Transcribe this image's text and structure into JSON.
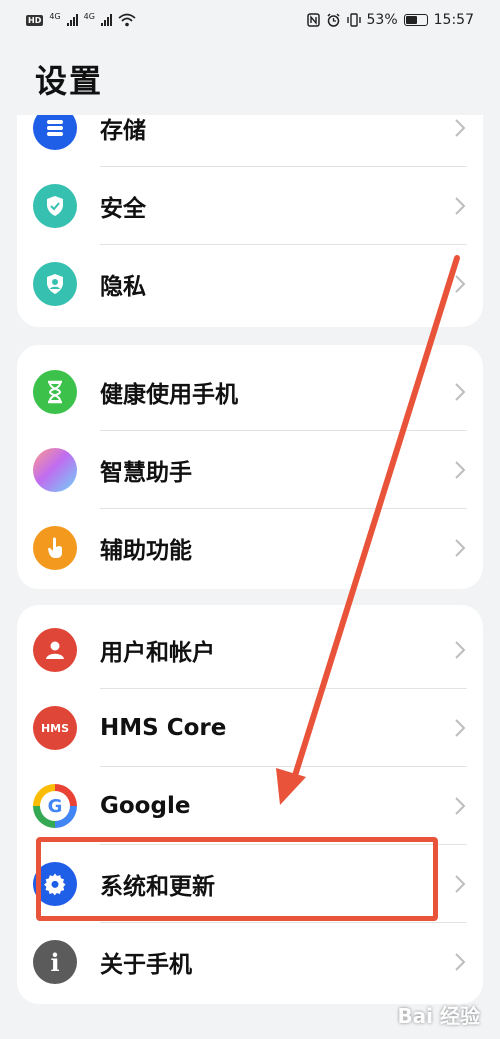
{
  "status_bar": {
    "left_tag": "HD",
    "network_1": "4G",
    "network_2": "4G",
    "battery": "53%",
    "battery_level": 0.53,
    "time": "15:57"
  },
  "page": {
    "title": "设置"
  },
  "colors": {
    "accent_red": "#e8533a",
    "blue": "#1f5ee7",
    "teal": "#35c0b0",
    "green": "#3cc24b",
    "orange": "#f39a1e",
    "red": "#e04638",
    "gray": "#5b5b5b"
  },
  "cards": [
    {
      "items": [
        {
          "label": "存储",
          "icon": "storage-icon"
        },
        {
          "label": "安全",
          "icon": "shield-icon"
        },
        {
          "label": "隐私",
          "icon": "privacy-icon"
        }
      ]
    },
    {
      "items": [
        {
          "label": "健康使用手机",
          "icon": "hourglass-icon"
        },
        {
          "label": "智慧助手",
          "icon": "assistant-icon"
        },
        {
          "label": "辅助功能",
          "icon": "accessibility-icon"
        }
      ]
    },
    {
      "items": [
        {
          "label": "用户和帐户",
          "icon": "user-icon"
        },
        {
          "label": "HMS Core",
          "icon": "hms-icon",
          "icon_text": "HMS"
        },
        {
          "label": "Google",
          "icon": "google-icon",
          "icon_text": "G"
        },
        {
          "label": "系统和更新",
          "icon": "gear-icon"
        },
        {
          "label": "关于手机",
          "icon": "info-icon",
          "icon_text": "i"
        }
      ]
    }
  ],
  "watermark": "Bai 经验"
}
